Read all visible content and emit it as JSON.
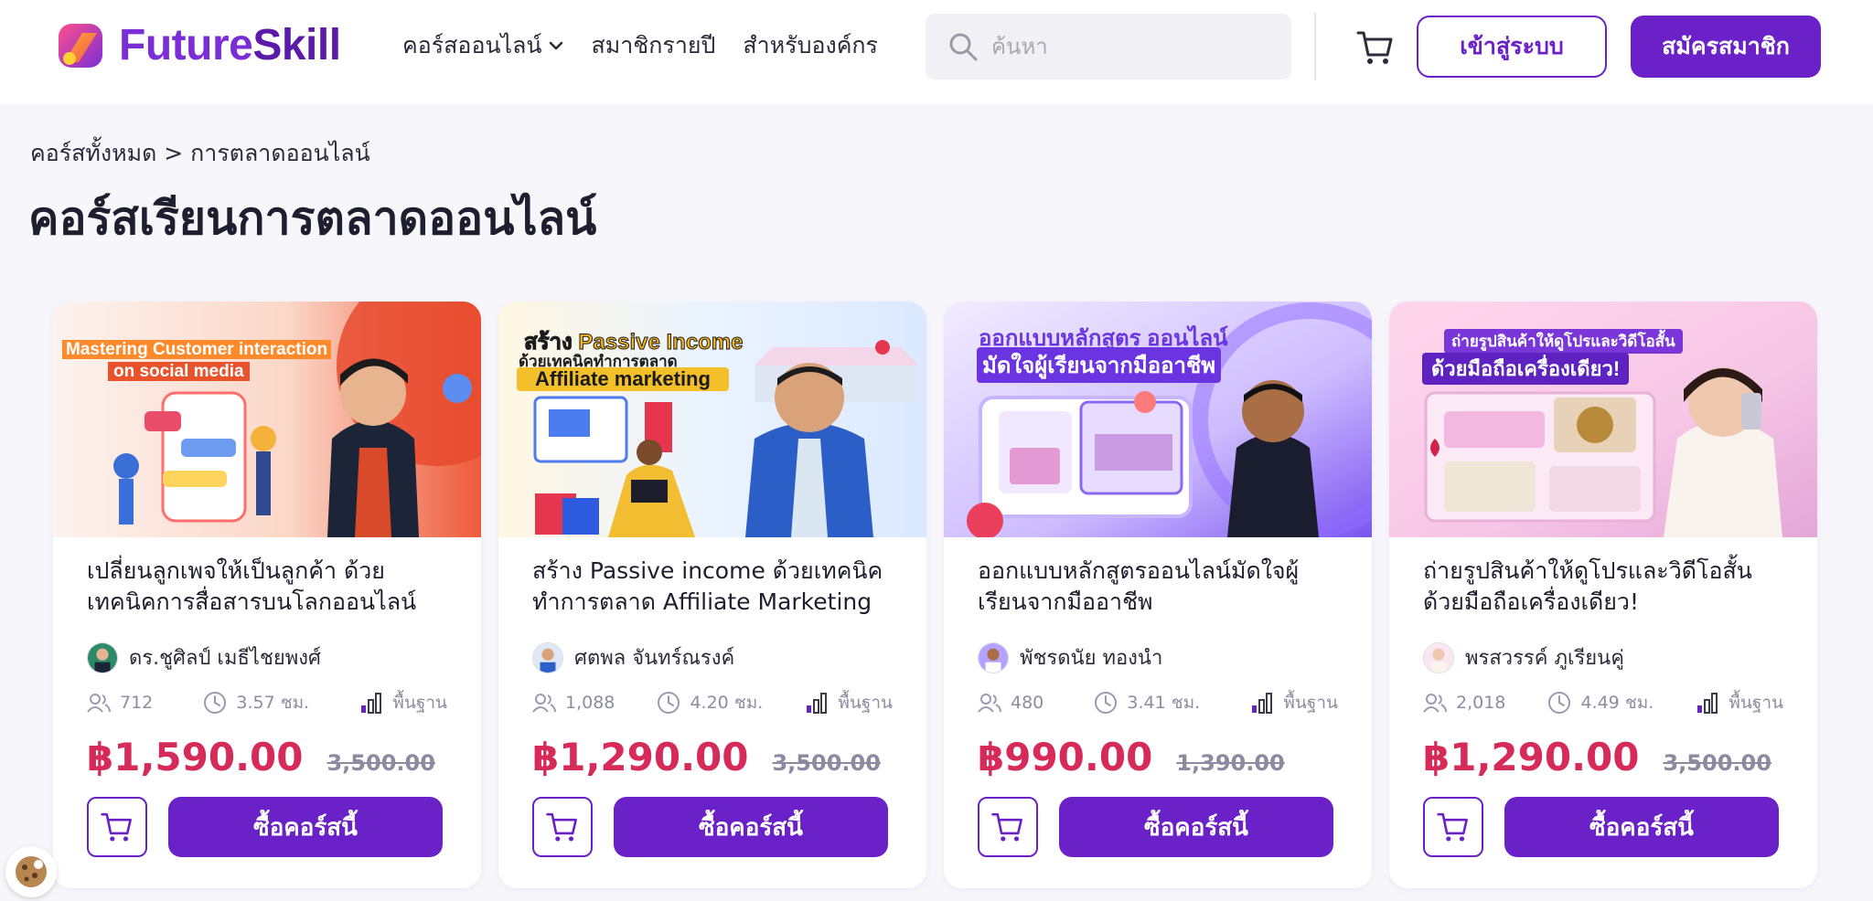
{
  "brand": {
    "name_part1": "Future",
    "name_part2": "Skill"
  },
  "nav": {
    "items": [
      "คอร์สออนไลน์",
      "สมาชิกรายปี",
      "สำหรับองค์กร"
    ]
  },
  "search": {
    "placeholder": "ค้นหา"
  },
  "header_buttons": {
    "login": "เข้าสู่ระบบ",
    "register": "สมัครสมาชิก"
  },
  "breadcrumb": "คอร์สทั้งหมด > การตลาดออนไลน์",
  "page_title": "คอร์สเรียนการตลาดออนไลน์",
  "colors": {
    "primary": "#6b21c8",
    "price": "#d62a5b",
    "background": "#f6f6fb"
  },
  "courses": [
    {
      "banner_line1": "Mastering Customer interaction",
      "banner_line2": "on social media",
      "title": "เปลี่ยนลูกเพจให้เป็นลูกค้า ด้วยเทคนิคการสื่อสารบนโลกออนไลน์",
      "instructor": "ดร.ชูศิลป์ เมธีไชยพงศ์",
      "students": "712",
      "duration": "3.57 ชม.",
      "level": "พื้นฐาน",
      "price": "฿1,590.00",
      "old_price": "3,500.00",
      "buy_label": "ซื้อคอร์สนี้"
    },
    {
      "banner_line1": "สร้าง Passive Income",
      "banner_line2": "ด้วยเทคนิคทำการตลาด",
      "banner_line3": "Affiliate marketing",
      "title": "สร้าง Passive income ด้วยเทคนิคทำการตลาด Affiliate Marketing",
      "instructor": "ศตพล จันทร์ณรงค์",
      "students": "1,088",
      "duration": "4.20 ชม.",
      "level": "พื้นฐาน",
      "price": "฿1,290.00",
      "old_price": "3,500.00",
      "buy_label": "ซื้อคอร์สนี้"
    },
    {
      "banner_line1": "ออกแบบหลักสูตร ออนไลน์",
      "banner_line2": "มัดใจผู้เรียนจากมืออาชีพ",
      "title": "ออกแบบหลักสูตรออนไลน์มัดใจผู้เรียนจากมืออาชีพ",
      "instructor": "พัชรดนัย ทองนำ",
      "students": "480",
      "duration": "3.41 ชม.",
      "level": "พื้นฐาน",
      "price": "฿990.00",
      "old_price": "1,390.00",
      "buy_label": "ซื้อคอร์สนี้"
    },
    {
      "banner_line1": "ถ่ายรูปสินค้าให้ดูโปรและวิดีโอสั้น",
      "banner_line2": "ด้วยมือถือเครื่องเดียว!",
      "title": "ถ่ายรูปสินค้าให้ดูโปรและวิดีโอสั้น ด้วยมือถือเครื่องเดียว!",
      "instructor": "พรสวรรค์ ภูเรียนคู่",
      "students": "2,018",
      "duration": "4.49 ชม.",
      "level": "พื้นฐาน",
      "price": "฿1,290.00",
      "old_price": "3,500.00",
      "buy_label": "ซื้อคอร์สนี้"
    }
  ]
}
